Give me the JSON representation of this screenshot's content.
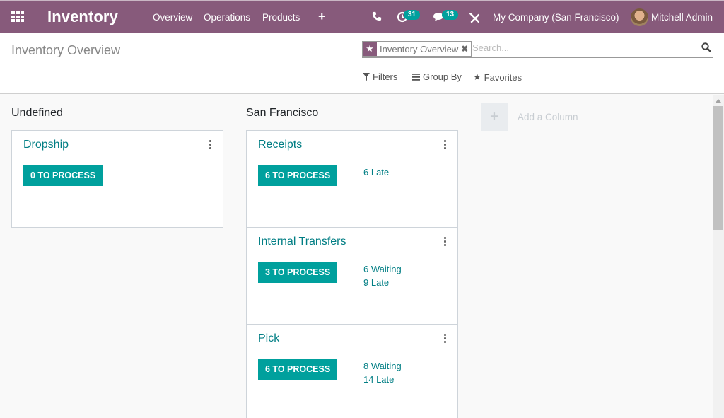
{
  "navbar": {
    "app_title": "Inventory",
    "menu": [
      "Overview",
      "Operations",
      "Products"
    ],
    "activity_count": "31",
    "message_count": "13",
    "company": "My Company (San Francisco)",
    "user": "Mitchell Admin"
  },
  "control": {
    "title": "Inventory Overview",
    "facet_label": "Inventory Overview",
    "search_placeholder": "Search...",
    "search_value": "",
    "filters_label": "Filters",
    "groupby_label": "Group By",
    "favorites_label": "Favorites"
  },
  "kanban": {
    "columns": [
      {
        "title": "Undefined",
        "cards": [
          {
            "name": "Dropship",
            "button": "0 TO PROCESS",
            "stats": []
          }
        ]
      },
      {
        "title": "San Francisco",
        "cards": [
          {
            "name": "Receipts",
            "button": "6 TO PROCESS",
            "stats": [
              "6 Late"
            ]
          },
          {
            "name": "Internal Transfers",
            "button": "3 TO PROCESS",
            "stats": [
              "6 Waiting",
              "9 Late"
            ]
          },
          {
            "name": "Pick",
            "button": "6 TO PROCESS",
            "stats": [
              "8 Waiting",
              "14 Late"
            ]
          }
        ]
      }
    ],
    "add_column_label": "Add a Column"
  },
  "colors": {
    "brand": "#875a7b",
    "accent": "#00a09d",
    "link": "#017e84"
  }
}
